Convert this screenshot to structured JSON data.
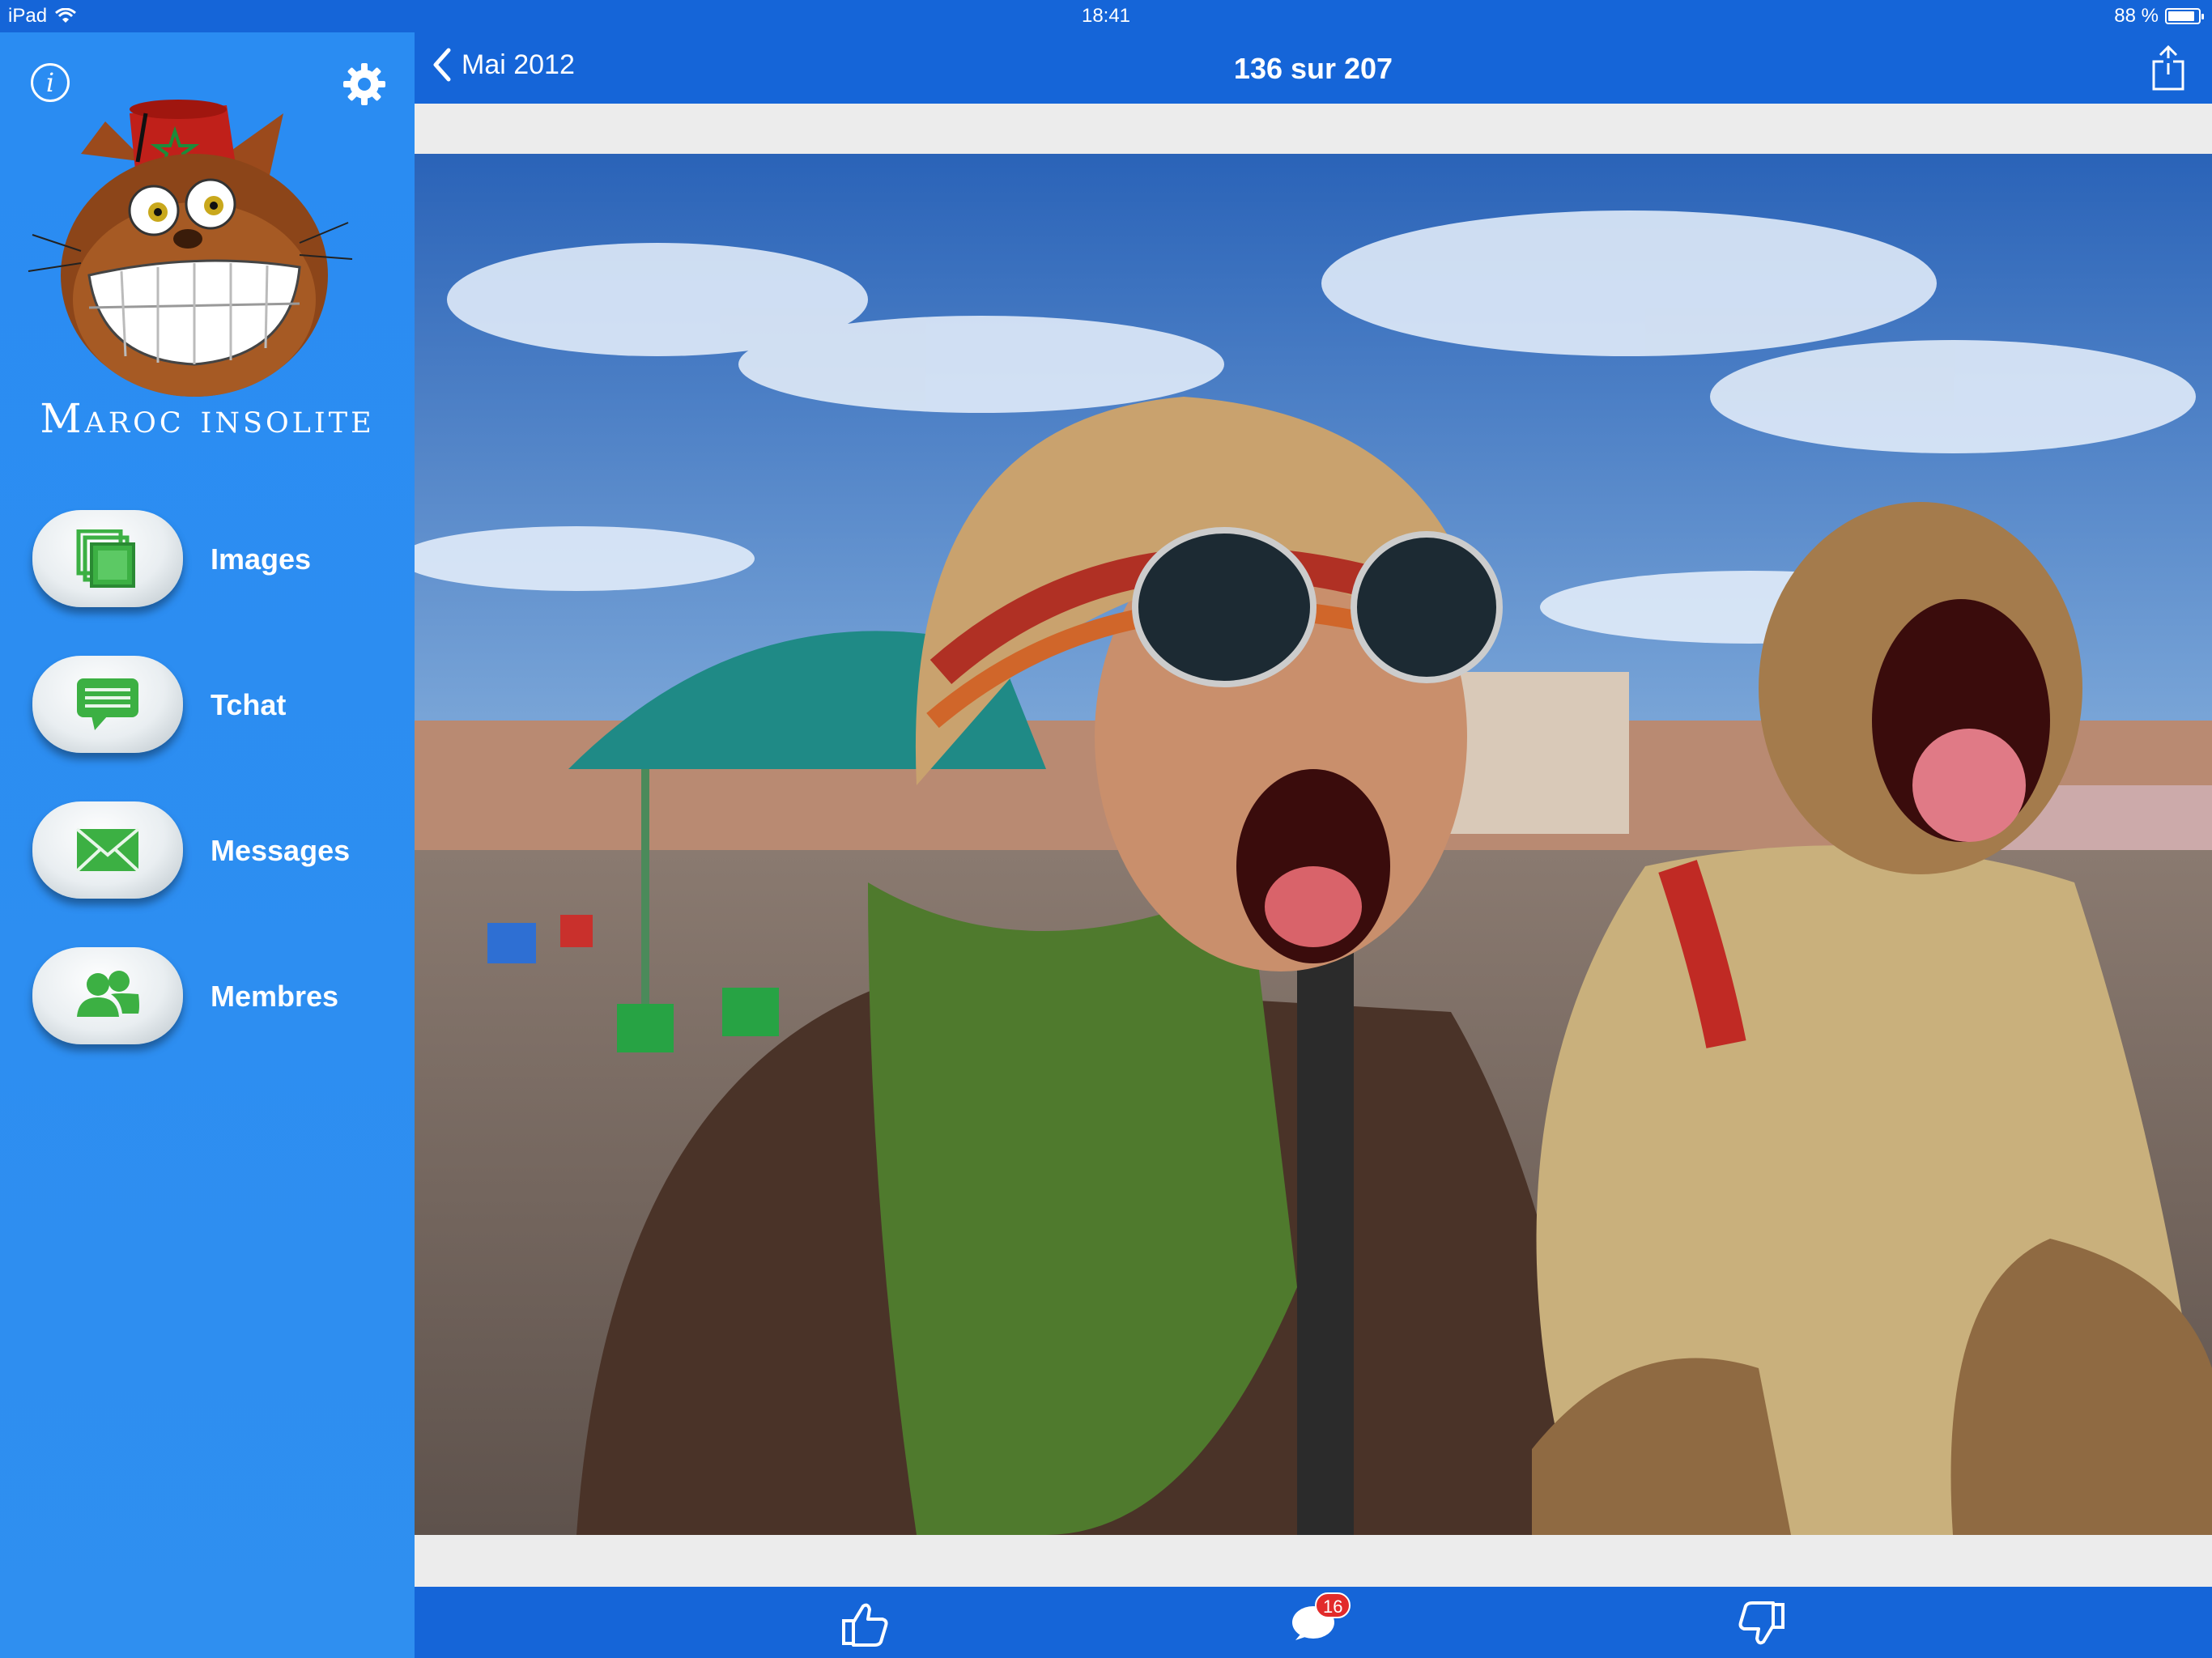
{
  "status": {
    "device": "iPad",
    "time": "18:41",
    "battery": "88 %",
    "battery_level": 0.88
  },
  "sidebar": {
    "brand": "Maroc insolite",
    "info_icon": "info-icon",
    "settings_icon": "gear-icon",
    "items": [
      {
        "label": "Images",
        "icon": "images-icon"
      },
      {
        "label": "Tchat",
        "icon": "chat-bubble-icon"
      },
      {
        "label": "Messages",
        "icon": "envelope-icon"
      },
      {
        "label": "Membres",
        "icon": "members-icon"
      }
    ]
  },
  "nav": {
    "back_label": "Mai 2012",
    "title": "136 sur 207",
    "share_icon": "share-icon"
  },
  "photo": {
    "subject": "photo"
  },
  "toolbar": {
    "like_icon": "thumbs-up-icon",
    "comments_icon": "comment-icon",
    "comments_count": "16",
    "dislike_icon": "thumbs-down-icon"
  },
  "colors": {
    "bar": "#1565d8",
    "sidebar": "#2a8cf2",
    "icon_green": "#3cb043",
    "badge": "#e22b2b"
  }
}
